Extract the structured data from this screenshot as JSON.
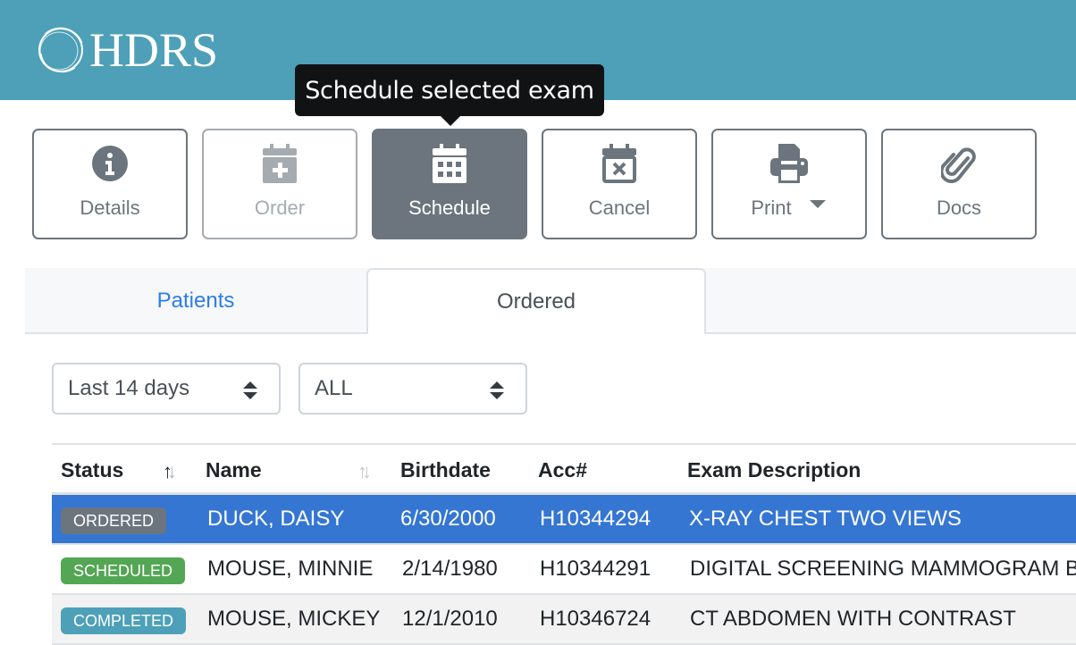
{
  "header": {
    "logo_text": "HDRS",
    "brand_color": "#4da0b8"
  },
  "tooltip": {
    "text": "Schedule selected exam"
  },
  "toolbar": {
    "buttons": [
      {
        "label": "Details",
        "icon": "info-circle-icon",
        "state": "enabled"
      },
      {
        "label": "Order",
        "icon": "calendar-plus-icon",
        "state": "disabled"
      },
      {
        "label": "Schedule",
        "icon": "calendar-icon",
        "state": "active"
      },
      {
        "label": "Cancel",
        "icon": "calendar-x-icon",
        "state": "enabled"
      },
      {
        "label": "Print",
        "icon": "printer-icon",
        "state": "enabled",
        "has_dropdown": true
      },
      {
        "label": "Docs",
        "icon": "paperclip-icon",
        "state": "enabled"
      }
    ]
  },
  "tabs": [
    {
      "label": "Patients",
      "active": false
    },
    {
      "label": "Ordered",
      "active": true
    }
  ],
  "filters": {
    "date_range": {
      "selected": "Last 14 days"
    },
    "status": {
      "selected": "ALL"
    }
  },
  "table": {
    "columns": [
      {
        "label": "Status",
        "sortable": true
      },
      {
        "label": "Name",
        "sortable": true
      },
      {
        "label": "Birthdate"
      },
      {
        "label": "Acc#"
      },
      {
        "label": "Exam Description"
      }
    ],
    "rows": [
      {
        "status": "ORDERED",
        "status_color": "#6c757d",
        "name": "DUCK, DAISY",
        "birthdate": "6/30/2000",
        "acc": "H10344294",
        "exam": "X-RAY CHEST TWO VIEWS",
        "selected": true
      },
      {
        "status": "SCHEDULED",
        "status_color": "#53a653",
        "name": "MOUSE, MINNIE",
        "birthdate": "2/14/1980",
        "acc": "H10344291",
        "exam": "DIGITAL SCREENING MAMMOGRAM B",
        "selected": false
      },
      {
        "status": "COMPLETED",
        "status_color": "#4da0b8",
        "name": "MOUSE, MICKEY",
        "birthdate": "12/1/2010",
        "acc": "H10346724",
        "exam": "CT ABDOMEN WITH CONTRAST",
        "selected": false
      }
    ],
    "selected_row_color": "#3576d3"
  }
}
